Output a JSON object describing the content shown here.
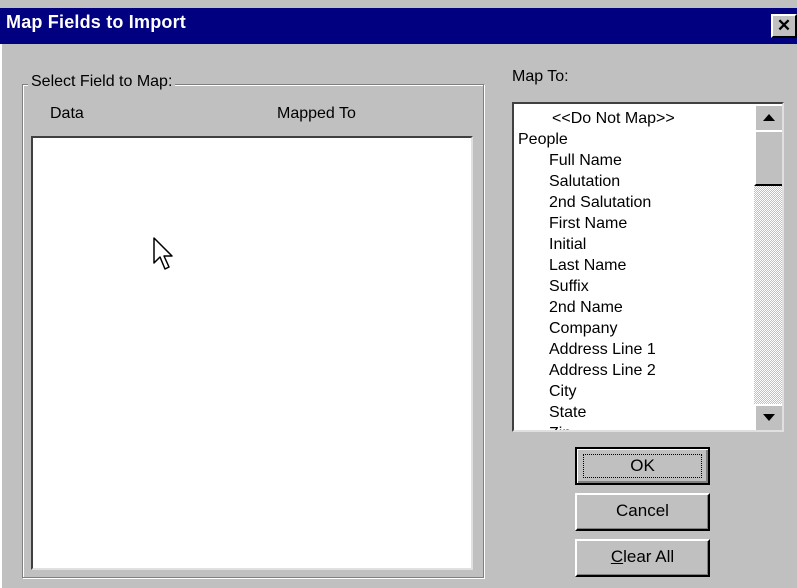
{
  "window": {
    "title": "Map Fields to Import",
    "close_glyph": "✕"
  },
  "group": {
    "label": "Select Field to Map:",
    "columns": [
      "Data",
      "Mapped To"
    ]
  },
  "mapto": {
    "label": "Map To:",
    "items": [
      {
        "text": "<<Do Not Map>>",
        "style": "center"
      },
      {
        "text": "People",
        "style": "root"
      },
      {
        "text": "Full Name",
        "style": "indent"
      },
      {
        "text": "Salutation",
        "style": "indent"
      },
      {
        "text": "2nd Salutation",
        "style": "indent"
      },
      {
        "text": "First Name",
        "style": "indent"
      },
      {
        "text": "Initial",
        "style": "indent"
      },
      {
        "text": "Last Name",
        "style": "indent"
      },
      {
        "text": "Suffix",
        "style": "indent"
      },
      {
        "text": "2nd Name",
        "style": "indent"
      },
      {
        "text": "Company",
        "style": "indent"
      },
      {
        "text": "Address Line 1",
        "style": "indent"
      },
      {
        "text": "Address Line 2",
        "style": "indent"
      },
      {
        "text": "City",
        "style": "indent"
      },
      {
        "text": "State",
        "style": "indent"
      },
      {
        "text": "Zip",
        "style": "indent"
      }
    ]
  },
  "buttons": {
    "ok": "OK",
    "cancel": "Cancel",
    "clear_all_prefix": "C",
    "clear_all_rest": "lear All"
  },
  "colors": {
    "titlebar": "#000080",
    "face": "#c0c0c0"
  }
}
